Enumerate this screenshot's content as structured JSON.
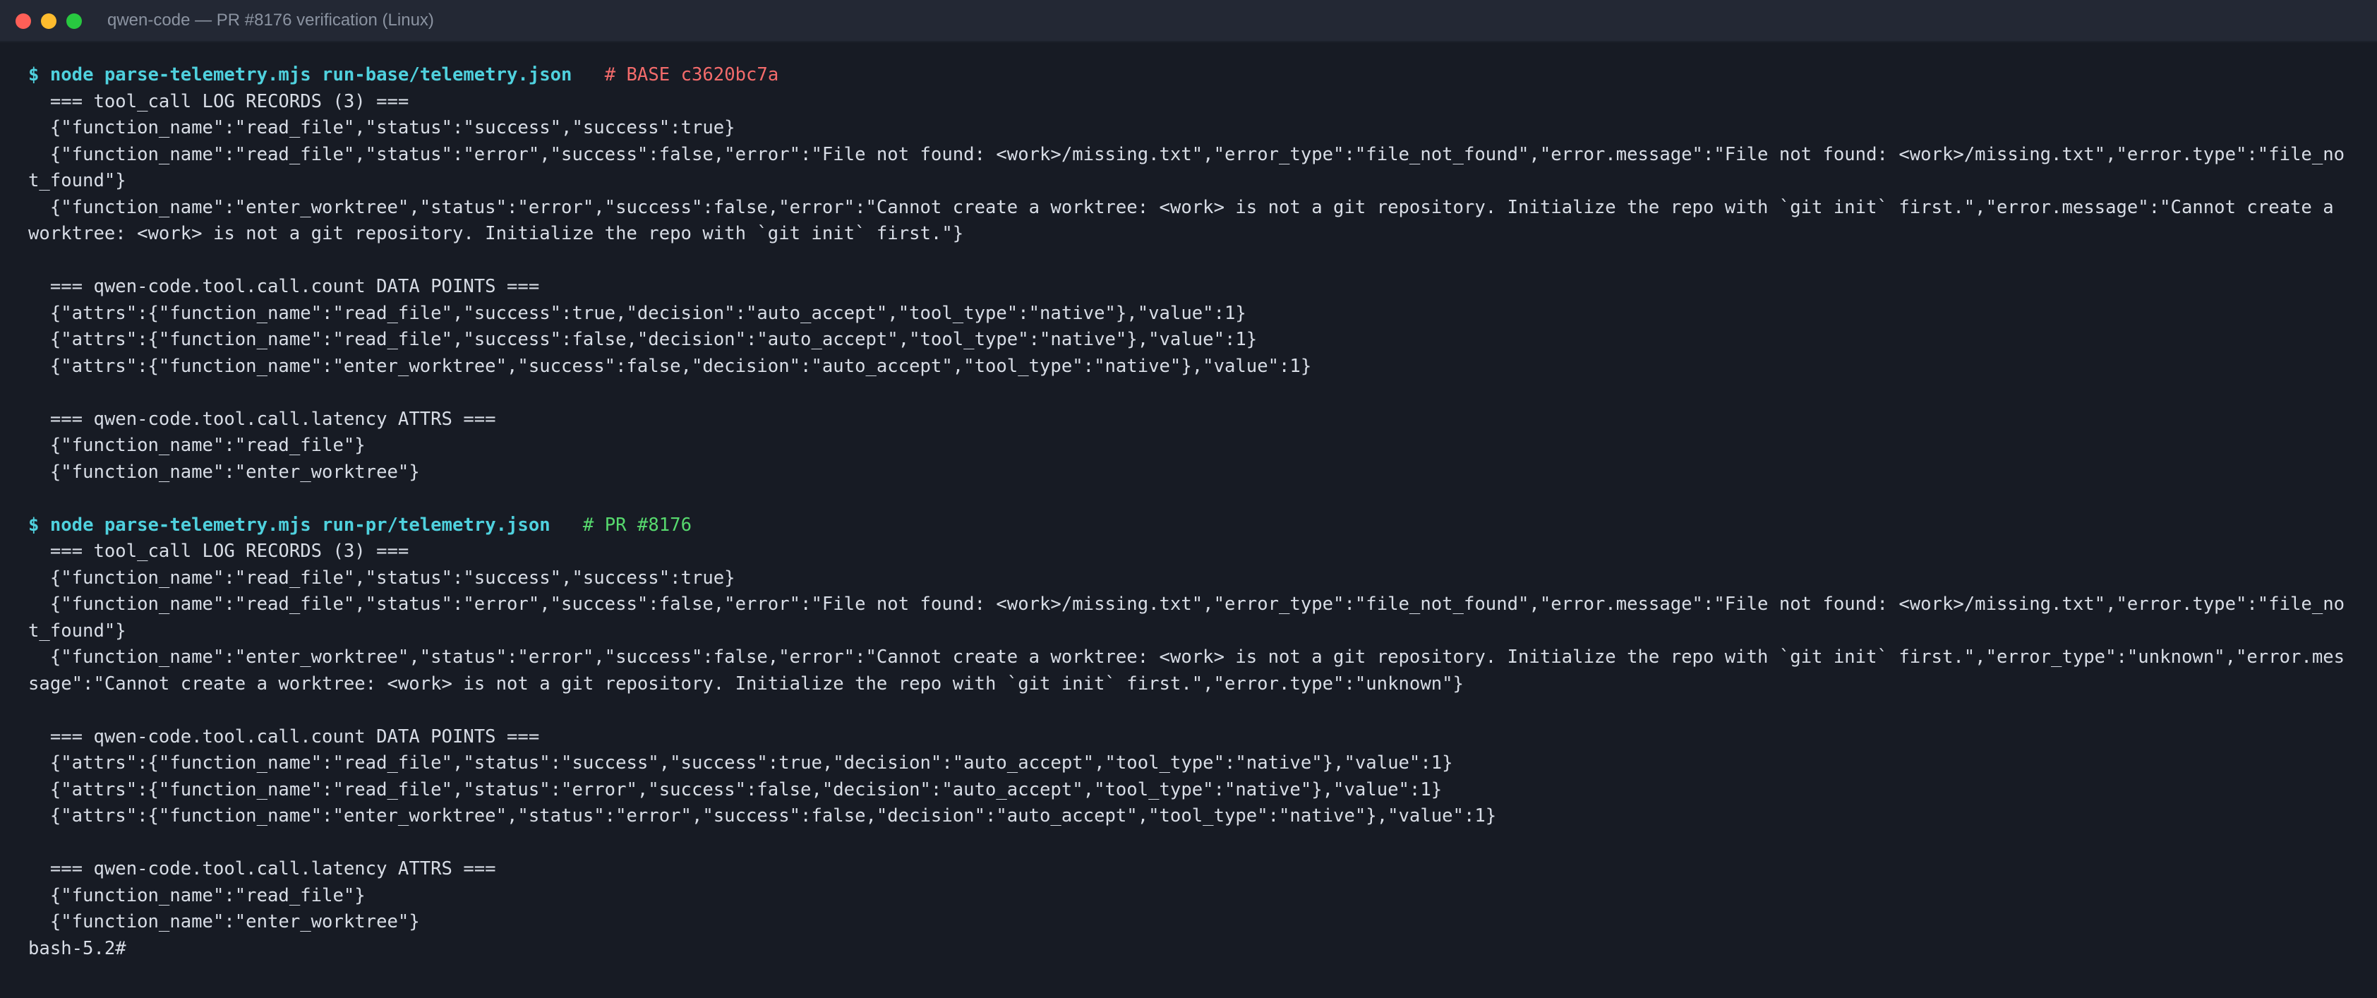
{
  "window": {
    "title": "qwen-code — PR #8176 verification (Linux)"
  },
  "terminal": {
    "prompt_symbol": "$",
    "base": {
      "command": "node parse-telemetry.mjs run-base/telemetry.json",
      "comment": "# BASE c3620bc7a",
      "log_header": "=== tool_call LOG RECORDS (3) ===",
      "log_lines": [
        "{\"function_name\":\"read_file\",\"status\":\"success\",\"success\":true}",
        "{\"function_name\":\"read_file\",\"status\":\"error\",\"success\":false,\"error\":\"File not found: <work>/missing.txt\",\"error_type\":\"file_not_found\",\"error.message\":\"File not found: <work>/missing.txt\",\"error.type\":\"file_not_found\"}",
        "{\"function_name\":\"enter_worktree\",\"status\":\"error\",\"success\":false,\"error\":\"Cannot create a worktree: <work> is not a git repository. Initialize the repo with `git init` first.\",\"error.message\":\"Cannot create a worktree: <work> is not a git repository. Initialize the repo with `git init` first.\"}"
      ],
      "count_header": "=== qwen-code.tool.call.count DATA POINTS ===",
      "count_lines": [
        "{\"attrs\":{\"function_name\":\"read_file\",\"success\":true,\"decision\":\"auto_accept\",\"tool_type\":\"native\"},\"value\":1}",
        "{\"attrs\":{\"function_name\":\"read_file\",\"success\":false,\"decision\":\"auto_accept\",\"tool_type\":\"native\"},\"value\":1}",
        "{\"attrs\":{\"function_name\":\"enter_worktree\",\"success\":false,\"decision\":\"auto_accept\",\"tool_type\":\"native\"},\"value\":1}"
      ],
      "latency_header": "=== qwen-code.tool.call.latency ATTRS ===",
      "latency_lines": [
        "{\"function_name\":\"read_file\"}",
        "{\"function_name\":\"enter_worktree\"}"
      ]
    },
    "pr": {
      "command": "node parse-telemetry.mjs run-pr/telemetry.json",
      "comment": "# PR #8176",
      "log_header": "=== tool_call LOG RECORDS (3) ===",
      "log_lines": [
        "{\"function_name\":\"read_file\",\"status\":\"success\",\"success\":true}",
        "{\"function_name\":\"read_file\",\"status\":\"error\",\"success\":false,\"error\":\"File not found: <work>/missing.txt\",\"error_type\":\"file_not_found\",\"error.message\":\"File not found: <work>/missing.txt\",\"error.type\":\"file_not_found\"}",
        "{\"function_name\":\"enter_worktree\",\"status\":\"error\",\"success\":false,\"error\":\"Cannot create a worktree: <work> is not a git repository. Initialize the repo with `git init` first.\",\"error_type\":\"unknown\",\"error.message\":\"Cannot create a worktree: <work> is not a git repository. Initialize the repo with `git init` first.\",\"error.type\":\"unknown\"}"
      ],
      "count_header": "=== qwen-code.tool.call.count DATA POINTS ===",
      "count_lines": [
        "{\"attrs\":{\"function_name\":\"read_file\",\"status\":\"success\",\"success\":true,\"decision\":\"auto_accept\",\"tool_type\":\"native\"},\"value\":1}",
        "{\"attrs\":{\"function_name\":\"read_file\",\"status\":\"error\",\"success\":false,\"decision\":\"auto_accept\",\"tool_type\":\"native\"},\"value\":1}",
        "{\"attrs\":{\"function_name\":\"enter_worktree\",\"status\":\"error\",\"success\":false,\"decision\":\"auto_accept\",\"tool_type\":\"native\"},\"value\":1}"
      ],
      "latency_header": "=== qwen-code.tool.call.latency ATTRS ===",
      "latency_lines": [
        "{\"function_name\":\"read_file\"}",
        "{\"function_name\":\"enter_worktree\"}"
      ]
    },
    "final_prompt": "bash-5.2#"
  },
  "colors": {
    "background": "#171b24",
    "titlebar": "#232834",
    "command": "#4fd1de",
    "comment_base": "#f36b6b",
    "comment_pr": "#57d96e",
    "text": "#d8dde6"
  }
}
